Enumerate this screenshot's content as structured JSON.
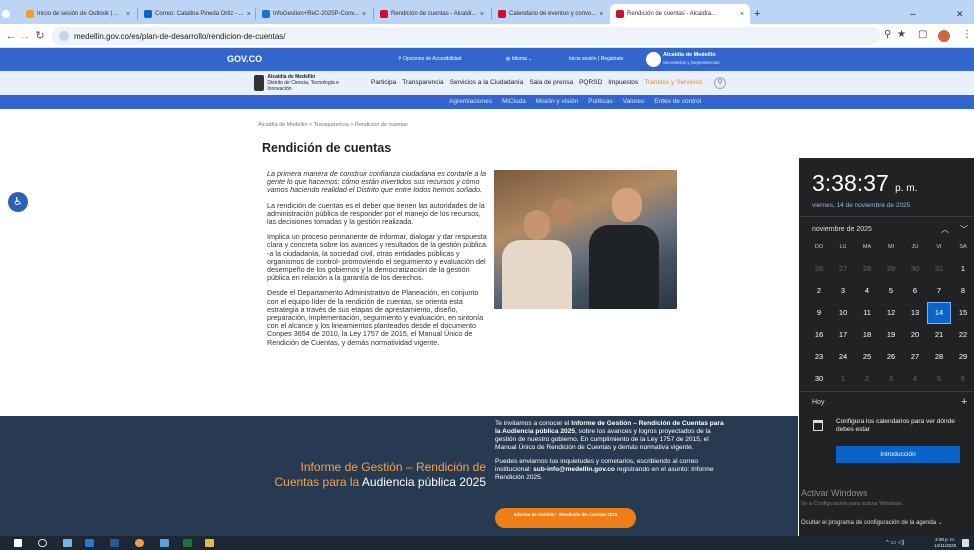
{
  "browser": {
    "tabs": [
      {
        "label": "Inicio de sesión de Outlook | ..."
      },
      {
        "label": "Correo: Catalina Pineda Ortiz - ..."
      },
      {
        "label": "InfoGestion+ReC-2025P-Conv..."
      },
      {
        "label": "Rendición de cuentas - Alcaldí..."
      },
      {
        "label": "Calendario de eventos y convo..."
      },
      {
        "label": "Rendición de cuentas - Alcaldía..."
      }
    ],
    "url": "medellin.gov.co/es/plan-de-desarrollo/rendicion-de-cuentas/"
  },
  "govbar": {
    "brand": "GOV.CO",
    "accessibility": "Opciones de Accesibilidad",
    "language": "Idioma",
    "login": "Inicia sesión | Registrate",
    "alcaldia": "Alcaldía de Medellín",
    "alcaldia_sub": "Secretarías y Dependencias"
  },
  "site": {
    "logo_title": "Alcaldía de Medellín",
    "logo_sub": "Distrito de Ciencia, Tecnología e Innovación",
    "nav": [
      "Participa",
      "Transparencia",
      "Servicios a la Ciudadanía",
      "Sala de prensa",
      "PQRSD",
      "Impuestos"
    ],
    "nav_highlight": "Trámites y Servicios",
    "subnav": [
      "Agremiaciones",
      "MiCiuda",
      "Misión y visión",
      "Políticas",
      "Valores",
      "Entes de control"
    ]
  },
  "page": {
    "breadcrumb": "Alcaldía de Medellín  >  Transparencia  >  Rendición de cuentas",
    "title": "Rendición de cuentas",
    "intro": "La primera manera de construir confianza ciudadana es contarle a la gente lo que hacemos: cómo están invertidos sus recursos y cómo vamos haciendo realidad el Distrito que entre todos hemos soñado.",
    "p1": "La rendición de cuentas es el deber que tienen las autoridades de la administración pública de responder por el manejo de los recursos, las decisiones tomadas y la gestión realizada.",
    "p2": "Implica un proceso permanente de informar, dialogar y dar respuesta clara y concreta sobre los avances y resultados de la gestión pública -a la ciudadanía, la sociedad civil, otras entidades públicas y organismos de control- promoviendo el seguimiento y evaluación del desempeño de los gobiernos y la democratización de la gestión pública en relación a la garantía de los derechos.",
    "p3": "Desde el Departamento Administrativo de Planeación, en conjunto con el equipo líder de la rendición de cuentas, se orienta esta estrategia a través de sus etapas de aprestamiento, diseño, preparación, implementación, seguimiento y evaluación, en sintonía con el alcance y los lineamientos planteados desde el documento Conpes 3654 de 2010, la Ley 1757 de 2015, el Manual Único de Rendición de Cuentas, y demás normatividad vigente."
  },
  "banner": {
    "title_a": "Informe de Gestión – Rendición de Cuentas para la ",
    "title_b": "Audiencia pública 2025",
    "text1_pre": "Te invitamos a conocer el ",
    "text1_bold": "Informe de Gestión – Rendición de Cuentas para la Audiencia pública 2025",
    "text1_post": ", sobre los avances y logros proyectados de la gestión de nuestro gobierno. En cumplimiento de la Ley 1757 de 2015, el Manual Único de Rendición de Cuentas y demás normativa vigente.",
    "text2_pre": "Puedes enviarnos tus inquietudes y cometarios, escribiendo al correo institucional: ",
    "text2_bold": "sub-info@medellin.gov.co",
    "text2_post": " registrando en el asunto: Informe Rendición 2025.",
    "button": "Informe de Gestión - Rendición de Cuentas 2025"
  },
  "calendar": {
    "time": "3:38:37",
    "ampm": "p. m.",
    "date_long": "viernes, 14 de noviembre de 2025",
    "month": "noviembre de 2025",
    "weekdays": [
      "DO",
      "LU",
      "MA",
      "MI",
      "JU",
      "VI",
      "SA"
    ],
    "days": [
      {
        "n": "26",
        "o": true
      },
      {
        "n": "27",
        "o": true
      },
      {
        "n": "28",
        "o": true
      },
      {
        "n": "29",
        "o": true
      },
      {
        "n": "30",
        "o": true
      },
      {
        "n": "31",
        "o": true
      },
      {
        "n": "1"
      },
      {
        "n": "2"
      },
      {
        "n": "3"
      },
      {
        "n": "4"
      },
      {
        "n": "5"
      },
      {
        "n": "6"
      },
      {
        "n": "7"
      },
      {
        "n": "8"
      },
      {
        "n": "9"
      },
      {
        "n": "10"
      },
      {
        "n": "11"
      },
      {
        "n": "12"
      },
      {
        "n": "13"
      },
      {
        "n": "14",
        "t": true
      },
      {
        "n": "15"
      },
      {
        "n": "16"
      },
      {
        "n": "17"
      },
      {
        "n": "18"
      },
      {
        "n": "19"
      },
      {
        "n": "20"
      },
      {
        "n": "21"
      },
      {
        "n": "22"
      },
      {
        "n": "23"
      },
      {
        "n": "24"
      },
      {
        "n": "25"
      },
      {
        "n": "26"
      },
      {
        "n": "27"
      },
      {
        "n": "28"
      },
      {
        "n": "29"
      },
      {
        "n": "30"
      },
      {
        "n": "1",
        "o": true
      },
      {
        "n": "2",
        "o": true
      },
      {
        "n": "3",
        "o": true
      },
      {
        "n": "4",
        "o": true
      },
      {
        "n": "5",
        "o": true
      },
      {
        "n": "6",
        "o": true
      }
    ],
    "today": "Hoy",
    "event_text": "Configura los calendarios para ver dónde debes estar",
    "intro_button": "Introducción",
    "activate_title": "Activar Windows",
    "activate_sub": "Ve a Configuración para activar Windows.",
    "hide_agenda": "Ocultar el programa de configuración de la agenda"
  },
  "taskbar": {
    "clock_time": "3:38 p. m.",
    "clock_date": "14/11/2025"
  }
}
